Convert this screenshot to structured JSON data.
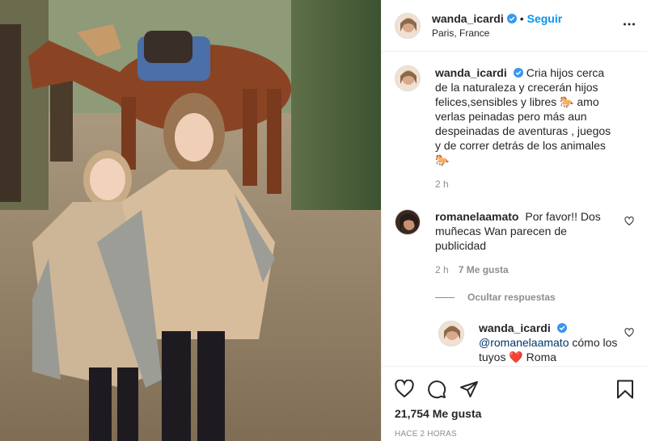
{
  "post": {
    "author": "wanda_icardi",
    "follow_label": "Seguir",
    "separator": "•",
    "location": "Paris, France"
  },
  "caption": {
    "author": "wanda_icardi",
    "text": "Cria hijos cerca de la naturaleza y crecerán hijos felices,sensibles y libres 🐎 amo verlas peinadas pero más aun despeinadas de aventuras , juegos y de correr detrás de los animales 🐎",
    "time": "2 h"
  },
  "comments": [
    {
      "author": "romanelaamato",
      "text": "Por favor!! Dos muñecas Wan parecen de publicidad",
      "time": "2 h",
      "likes": "7 Me gusta"
    }
  ],
  "hide_replies_label": "Ocultar respuestas",
  "reply": {
    "author": "wanda_icardi",
    "mention": "@romanelaamato",
    "text": " cómo los tuyos ",
    "emoji": "❤️",
    "tail": " Roma"
  },
  "footer": {
    "likes": "21,754 Me gusta",
    "time": "Hace 2 horas"
  },
  "icons": {
    "more": "more-options-icon",
    "like": "heart-icon",
    "comment": "comment-icon",
    "share": "paper-plane-icon",
    "save": "bookmark-icon",
    "verified": "verified-badge-icon"
  },
  "colors": {
    "accent": "#0095f6",
    "verified": "#3897f0",
    "muted": "#8e8e8e",
    "text": "#262626",
    "border": "#efefef"
  }
}
